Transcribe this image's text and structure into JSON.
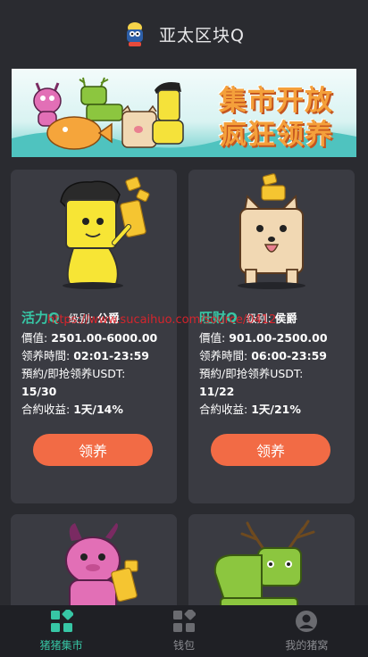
{
  "header": {
    "title": "亚太区块Q"
  },
  "banner": {
    "line1": "集市开放",
    "line2": "疯狂领养"
  },
  "watermark": "https://www.sucaihuo.com/source/0412",
  "cards": [
    {
      "name": "活力Q",
      "level_label": "级别:",
      "level": "公爵",
      "price_label": "價值:",
      "price": "2501.00-6000.00",
      "time_label": "领养時間:",
      "time": "02:01-23:59",
      "reserve_label": "預約/即抢领养USDT:",
      "reserve": "15/30",
      "yield_label": "合約收益:",
      "yield": "1天/14%",
      "button": "领养",
      "art": "yellow-mascot"
    },
    {
      "name": "旺财Q",
      "level_label": "级别:",
      "level": "侯爵",
      "price_label": "價值:",
      "price": "901.00-2500.00",
      "time_label": "领养時間:",
      "time": "06:00-23:59",
      "reserve_label": "預約/即抢领养USDT:",
      "reserve": "11/22",
      "yield_label": "合約收益:",
      "yield": "1天/21%",
      "button": "领养",
      "art": "tan-dog"
    },
    {
      "art": "pink-monster"
    },
    {
      "art": "green-deer"
    }
  ],
  "nav": [
    {
      "label": "猪猪集市",
      "icon": "market-icon",
      "active": true
    },
    {
      "label": "钱包",
      "icon": "wallet-icon",
      "active": false
    },
    {
      "label": "我的猪窝",
      "icon": "profile-icon",
      "active": false
    }
  ],
  "colors": {
    "accent": "#37c6a5",
    "button": "#f26b45",
    "card": "#3a3b42",
    "background": "#2a2b30"
  }
}
